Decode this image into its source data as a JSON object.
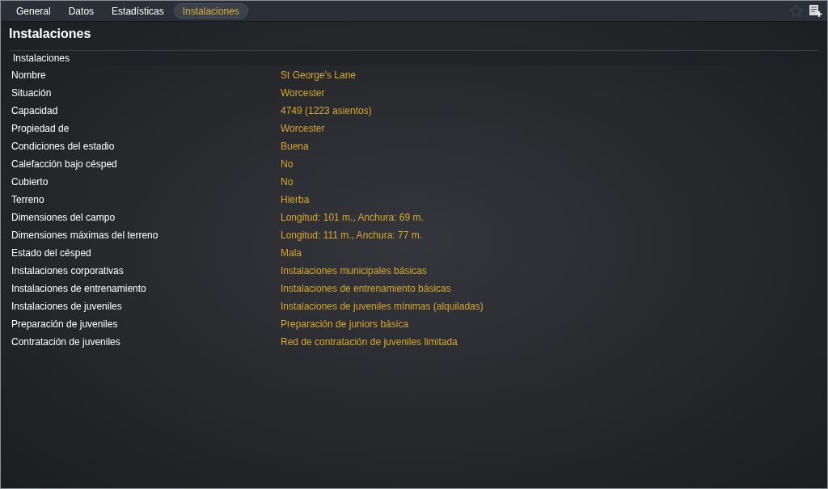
{
  "tabs": [
    {
      "label": "General",
      "selected": false
    },
    {
      "label": "Datos",
      "selected": false
    },
    {
      "label": "Estadísticas",
      "selected": false
    },
    {
      "label": "Instalaciones",
      "selected": true
    }
  ],
  "page_title": "Instalaciones",
  "section": {
    "title": "Instalaciones",
    "rows": [
      {
        "label": "Nombre",
        "value": "St George's Lane"
      },
      {
        "label": "Situación",
        "value": "Worcester"
      },
      {
        "label": "Capacidad",
        "value": "4749 (1223 asientos)"
      },
      {
        "label": "Propiedad de",
        "value": "Worcester"
      },
      {
        "label": "Condiciones del estadio",
        "value": "Buena"
      },
      {
        "label": "Calefacción bajo césped",
        "value": "No"
      },
      {
        "label": "Cubierto",
        "value": "No"
      },
      {
        "label": "Terreno",
        "value": "Hierba"
      },
      {
        "label": "Dimensiones del campo",
        "value": "Longitud: 101 m., Anchura: 69 m."
      },
      {
        "label": "Dimensiones máximas del terreno",
        "value": "Longitud: 111 m., Anchura: 77 m."
      },
      {
        "label": "Estado del césped",
        "value": "Mala"
      },
      {
        "label": "Instalaciones corporativas",
        "value": "Instalaciones municipales básicas"
      },
      {
        "label": "Instalaciones de entrenamiento",
        "value": "Instalaciones de entrenamiento básicas"
      },
      {
        "label": "Instalaciones de juveniles",
        "value": "Instalaciones de juveniles mínimas (alquiladas)"
      },
      {
        "label": "Preparación de juveniles",
        "value": "Preparación de juniors básica"
      },
      {
        "label": "Contratación de juveniles",
        "value": "Red de contratación de juveniles limitada"
      }
    ]
  }
}
